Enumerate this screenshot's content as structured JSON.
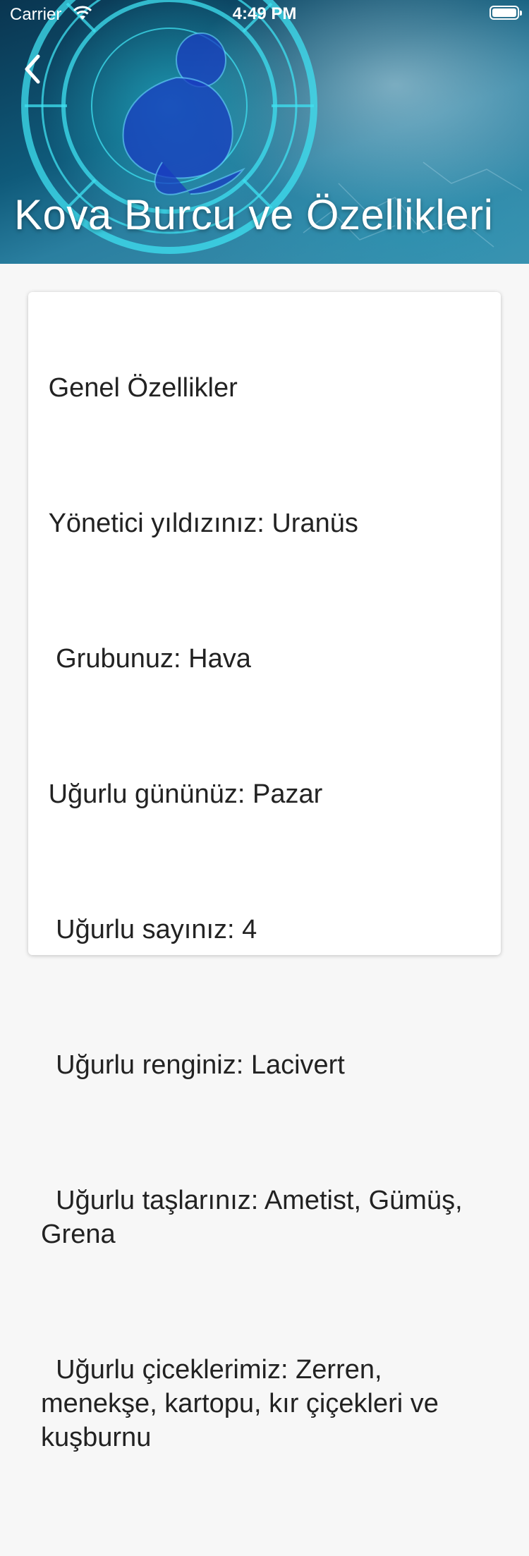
{
  "status_bar": {
    "carrier": "Carrier",
    "time": "4:49 PM"
  },
  "header": {
    "title": "Kova Burcu ve Özellikleri",
    "back_icon": "chevron-left-icon"
  },
  "content": {
    "paragraphs": [
      " Genel Özellikler",
      " Yönetici yıldızınız: Uranüs",
      "  Grubunuz: Hava",
      " Uğurlu gününüz: Pazar",
      "  Uğurlu sayınız: 4",
      "  Uğurlu renginiz: Lacivert",
      "  Uğurlu taşlarınız: Ametist, Gümüş, Grena",
      "  Uğurlu çiceklerimiz: Zerren, menekşe, kartopu, kır çiçekleri ve kuşburnu"
    ]
  }
}
